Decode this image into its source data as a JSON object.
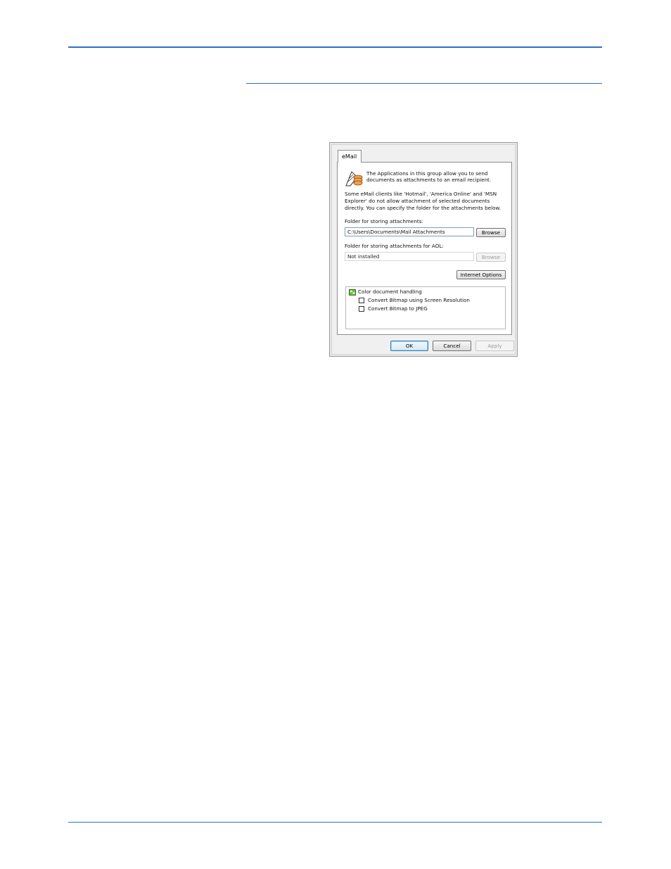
{
  "dialog": {
    "tab_label": "eMail",
    "intro_line1": "The Applications in this group allow you to send",
    "intro_line2": "documents as attachments to an email recipient.",
    "note_line1": "Some eMail clients like 'Hotmail', 'America Online' and 'MSN",
    "note_line2": "Explorer' do not allow attachment of selected documents",
    "note_line3": "directly. You can specify the folder for the attachments below.",
    "folder_label": "Folder for storing attachments:",
    "folder_value": "C:\\Users\\Documents\\Mail Attachments",
    "browse_label": "Browse",
    "aol_label": "Folder for storing attachments for AOL:",
    "aol_value": "Not installed",
    "aol_browse_label": "Browse",
    "internet_options_label": "Internet Options",
    "group_title": "Color document handling",
    "options": [
      {
        "label": "Convert Bitmap using Screen Resolution",
        "checked": false
      },
      {
        "label": "Convert Bitmap to JPEG",
        "checked": false
      }
    ],
    "ok_label": "OK",
    "cancel_label": "Cancel",
    "apply_label": "Apply"
  }
}
